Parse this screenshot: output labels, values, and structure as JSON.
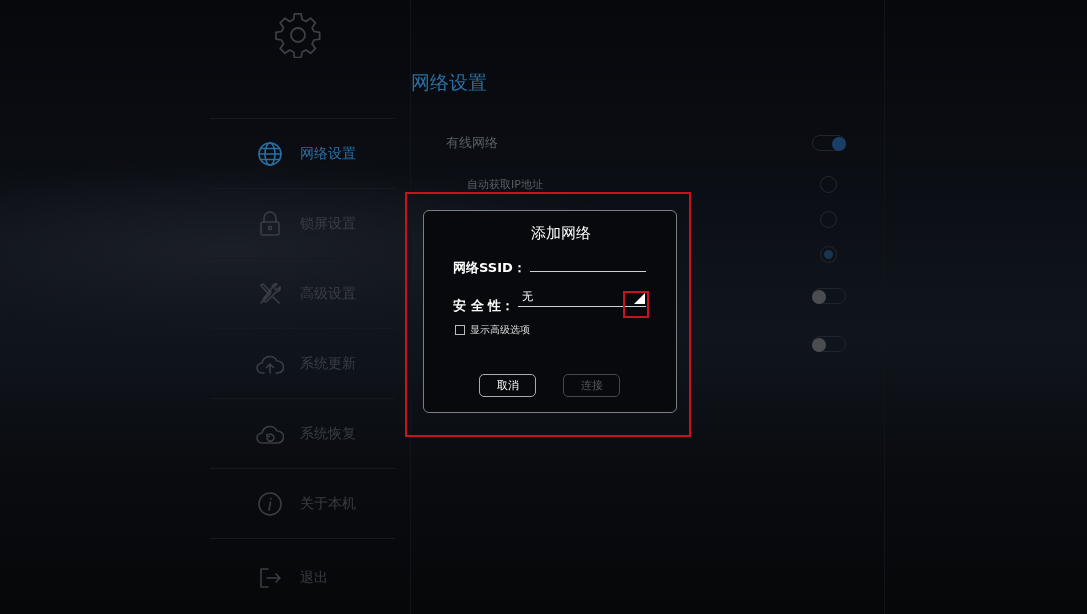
{
  "sidebar": {
    "items": [
      {
        "kind": "globe",
        "label": "网络设置",
        "selected": true
      },
      {
        "kind": "lock",
        "label": "锁屏设置",
        "selected": false
      },
      {
        "kind": "tools",
        "label": "高级设置",
        "selected": false
      },
      {
        "kind": "cloud-up",
        "label": "系统更新",
        "selected": false
      },
      {
        "kind": "cloud-restore",
        "label": "系统恢复",
        "selected": false
      },
      {
        "kind": "info",
        "label": "关于本机",
        "selected": false
      },
      {
        "kind": "exit",
        "label": "退出",
        "selected": false
      }
    ]
  },
  "panel": {
    "title": "网络设置",
    "rows": [
      {
        "kind": "toggle",
        "label": "有线网络",
        "on": true
      },
      {
        "kind": "radio",
        "label": "自动获取IP地址",
        "selected": false
      },
      {
        "kind": "radio",
        "selected": false
      },
      {
        "kind": "radio",
        "selected": true
      },
      {
        "kind": "toggle",
        "on": false
      },
      {
        "kind": "toggle",
        "on": false
      }
    ]
  },
  "dialog": {
    "title": "添加网络",
    "fields": [
      {
        "kind": "text",
        "label": "网络SSID："
      },
      {
        "kind": "select",
        "label": "安 全 性：",
        "value": "无"
      }
    ],
    "checkbox": {
      "label": "显示高级选项",
      "checked": false
    },
    "buttons": [
      {
        "label": "取消",
        "disabled": false
      },
      {
        "label": "连接",
        "disabled": true
      }
    ]
  }
}
